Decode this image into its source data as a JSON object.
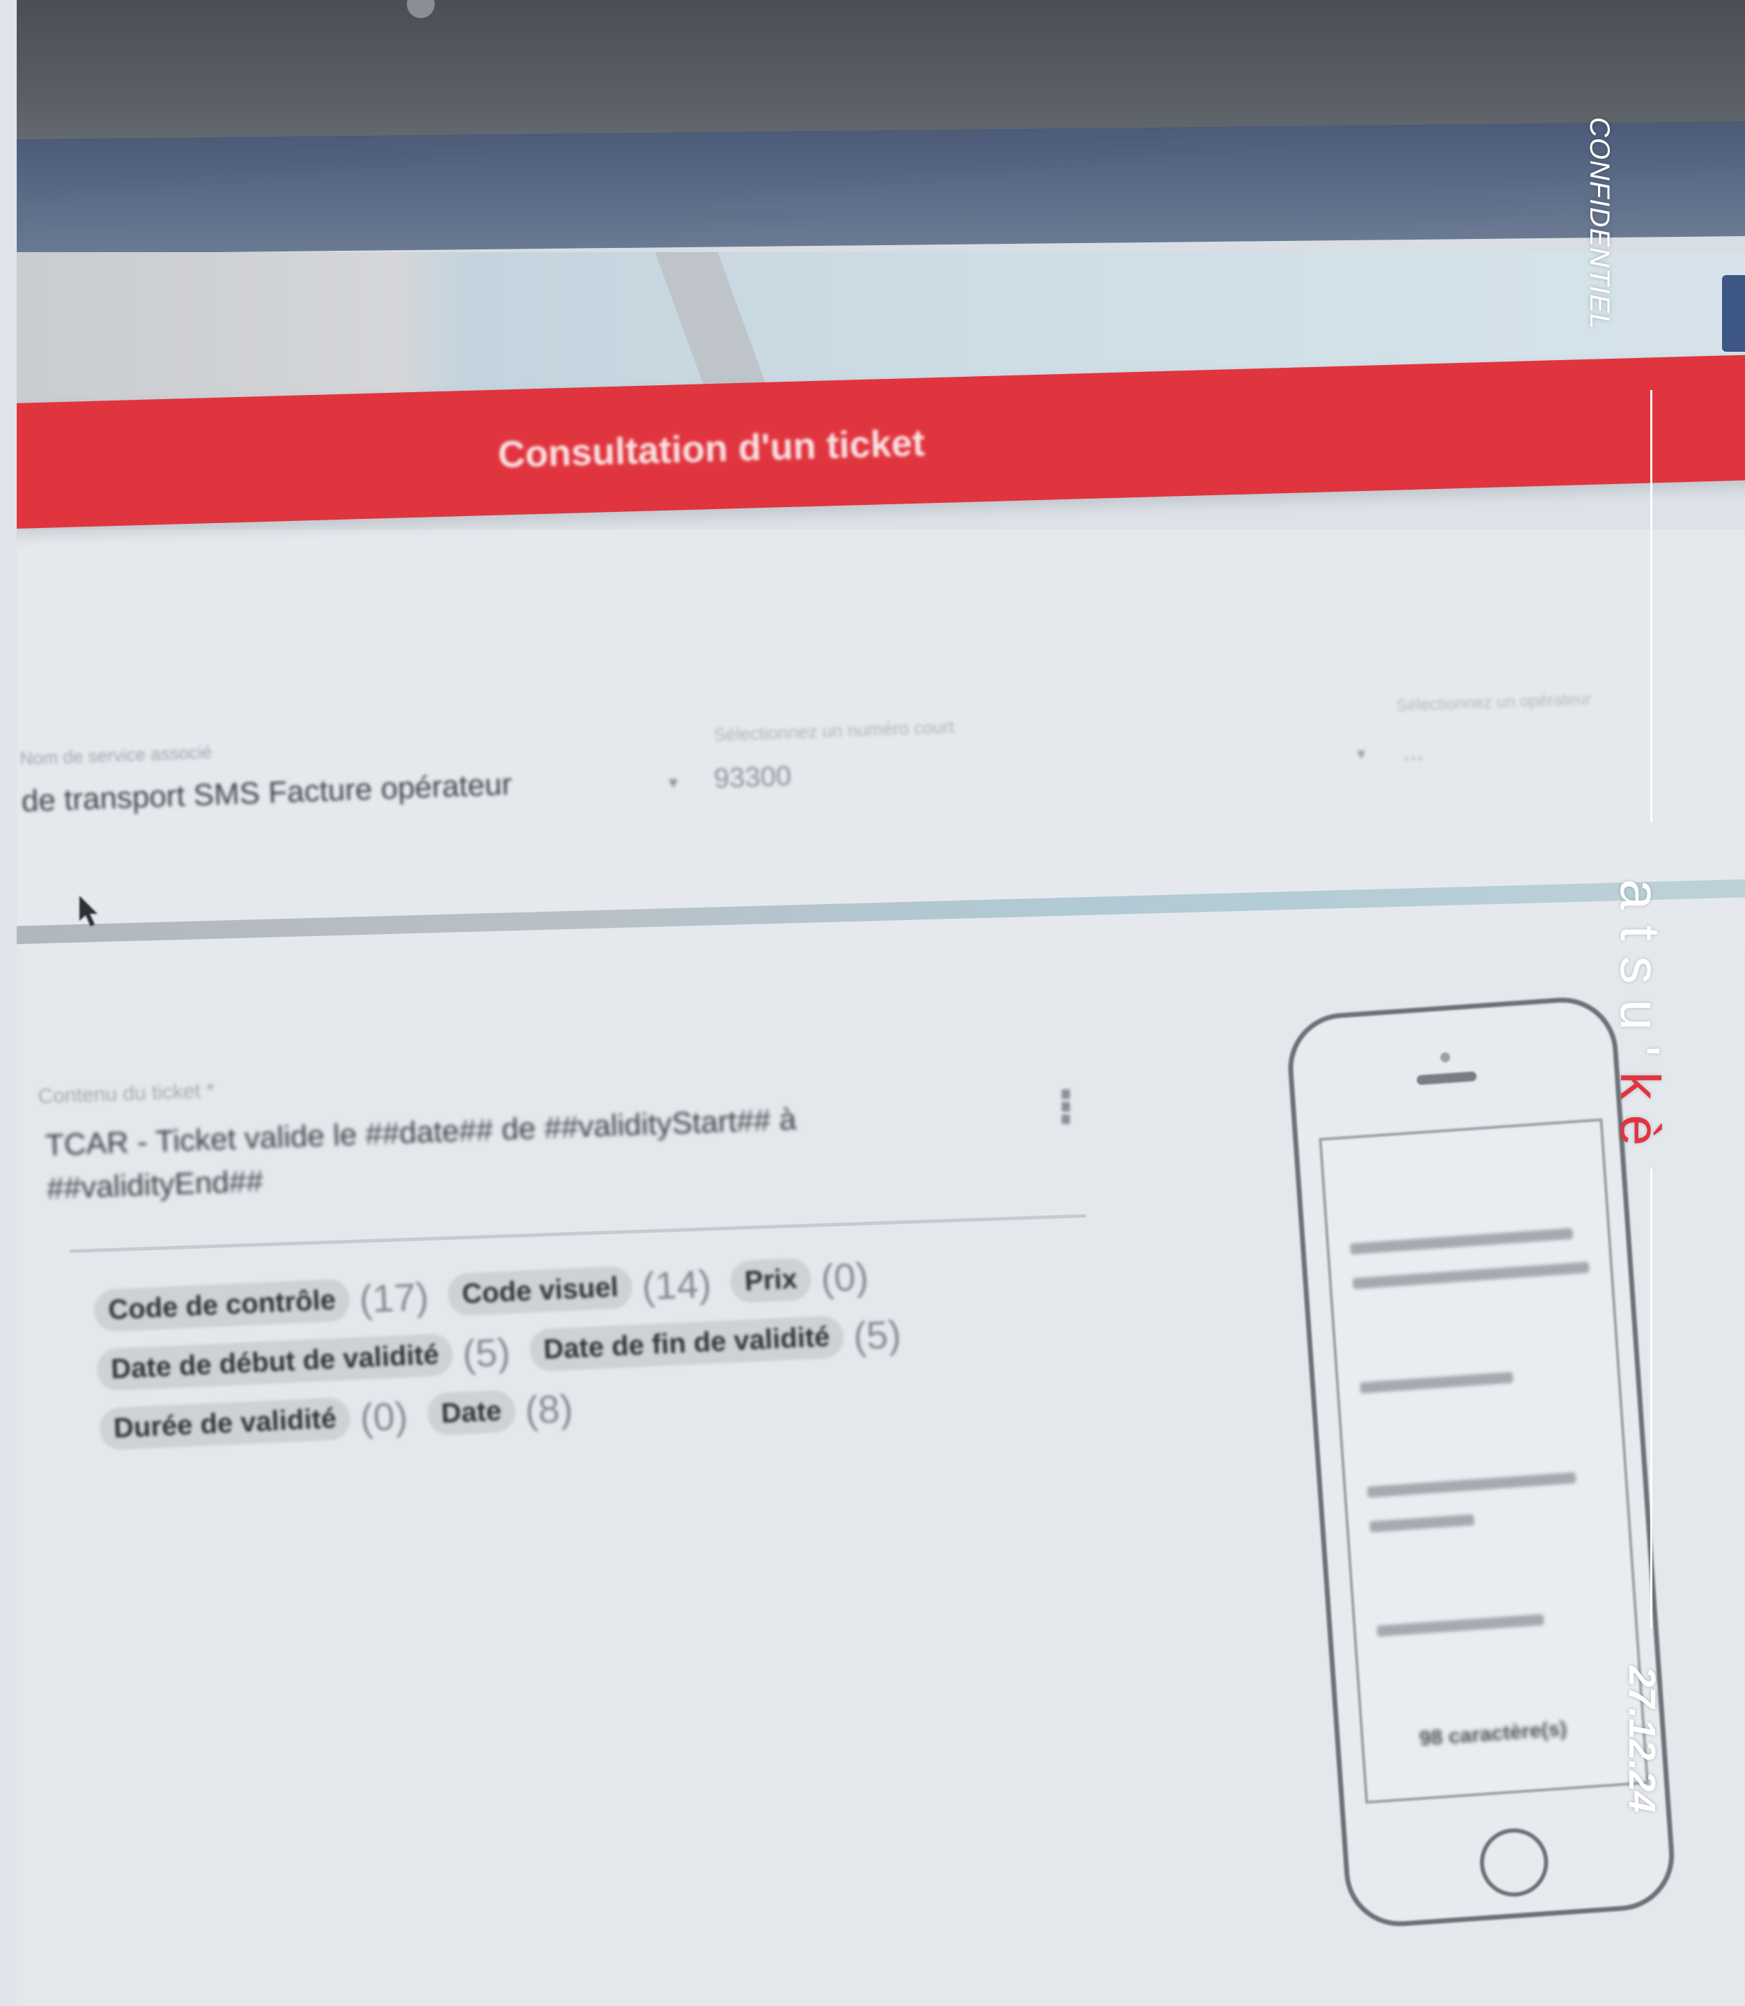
{
  "header": {
    "title": "Consultation d'un ticket"
  },
  "form": {
    "service_label": "Nom de service associé",
    "service_value": "de transport SMS Facture opérateur",
    "number_label": "Sélectionnez un numéro court",
    "number_value": "93300",
    "third_label": "Sélectionnez un opérateur",
    "third_value": "..."
  },
  "ticket": {
    "label": "Contenu du ticket *",
    "content": "TCAR - Ticket valide le ##date## de ##validityStart## à ##validityEnd##"
  },
  "chips": [
    {
      "label": "Code de contrôle",
      "count": "(17)"
    },
    {
      "label": "Code visuel",
      "count": "(14)"
    },
    {
      "label": "Prix",
      "count": "(0)"
    },
    {
      "label": "Date de début de validité",
      "count": "(5)"
    },
    {
      "label": "Date de fin de validité",
      "count": "(5)"
    },
    {
      "label": "Durée de validité",
      "count": "(0)"
    },
    {
      "label": "Date",
      "count": "(8)"
    }
  ],
  "preview": {
    "character_count": "98 caractère(s)"
  },
  "brand": {
    "confidential": "CONFIDENTIEL",
    "logo_main": "atsu'",
    "logo_accent": "kè",
    "date": "27.12.24",
    "accent_color": "#e0353f"
  }
}
